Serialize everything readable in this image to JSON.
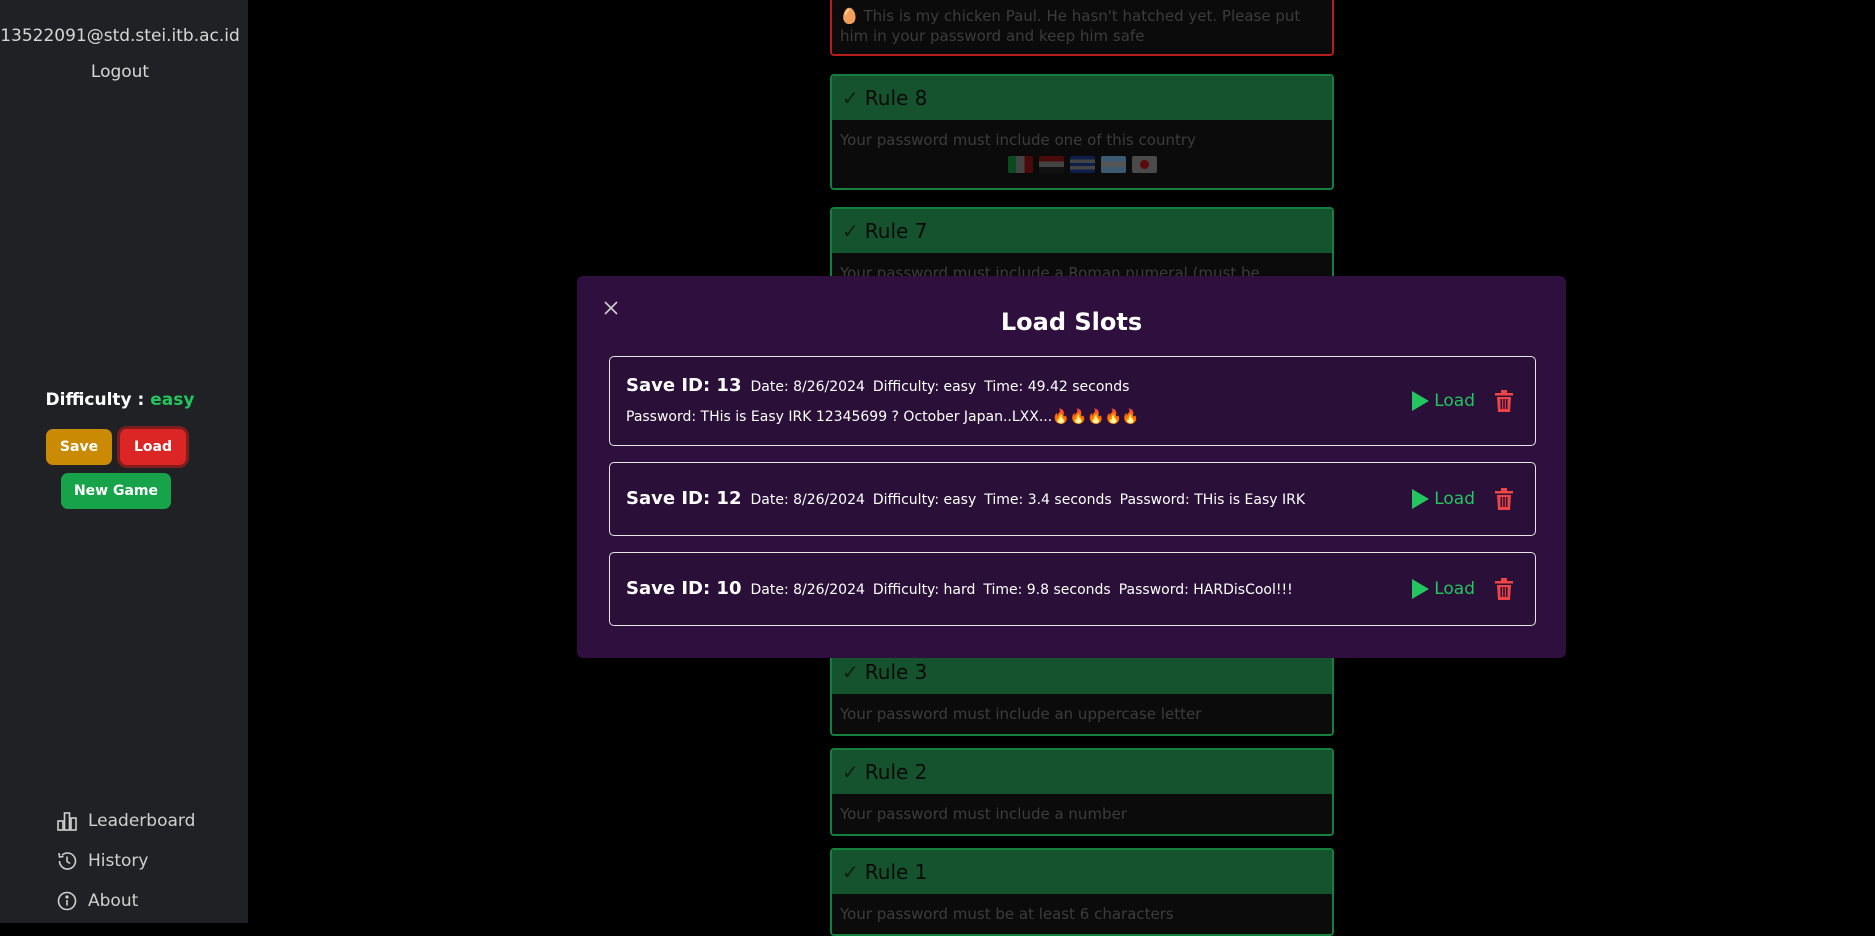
{
  "sidebar": {
    "email": "13522091@std.stei.itb.ac.id",
    "logout": "Logout",
    "difficulty_label": "Difficulty :",
    "difficulty_value": "easy",
    "save_label": "Save",
    "load_label": "Load",
    "new_game_label": "New Game",
    "nav": [
      {
        "label": "Leaderboard",
        "icon": "bar-chart-icon"
      },
      {
        "label": "History",
        "icon": "history-icon"
      },
      {
        "label": "About",
        "icon": "info-icon"
      }
    ]
  },
  "rules": {
    "top": {
      "text": "🥚 This is my chicken Paul. He hasn't hatched yet. Please put him in your password and keep him safe"
    },
    "r8": {
      "title": "Rule 8",
      "text": "Your password must include one of this country"
    },
    "r7": {
      "title": "Rule 7",
      "text": "Your password must include a Roman numeral (must be"
    },
    "r3": {
      "title": "Rule 3",
      "text": "Your password must include an uppercase letter"
    },
    "r2": {
      "title": "Rule 2",
      "text": "Your password must include a number"
    },
    "r1": {
      "title": "Rule 1",
      "text": "Your password must be at least 6 characters"
    }
  },
  "modal": {
    "title": "Load Slots",
    "load_label": "Load",
    "slots": [
      {
        "id": "Save ID: 13",
        "date": "Date: 8/26/2024",
        "difficulty": "Difficulty: easy",
        "time": "Time: 49.42 seconds",
        "password": "Password: THis is Easy IRK 12345699 ? October Japan..LXX...🔥🔥🔥🔥🔥"
      },
      {
        "id": "Save ID: 12",
        "date": "Date: 8/26/2024",
        "difficulty": "Difficulty: easy",
        "time": "Time: 3.4 seconds",
        "password": "Password: THis is Easy IRK"
      },
      {
        "id": "Save ID: 10",
        "date": "Date: 8/26/2024",
        "difficulty": "Difficulty: hard",
        "time": "Time: 9.8 seconds",
        "password": "Password: HARDisCool!!!"
      }
    ]
  },
  "colors": {
    "accent_green": "#22c55e",
    "danger": "#dc2626",
    "modal_bg": "#2e0f3e",
    "warning": "#ca8a04"
  }
}
